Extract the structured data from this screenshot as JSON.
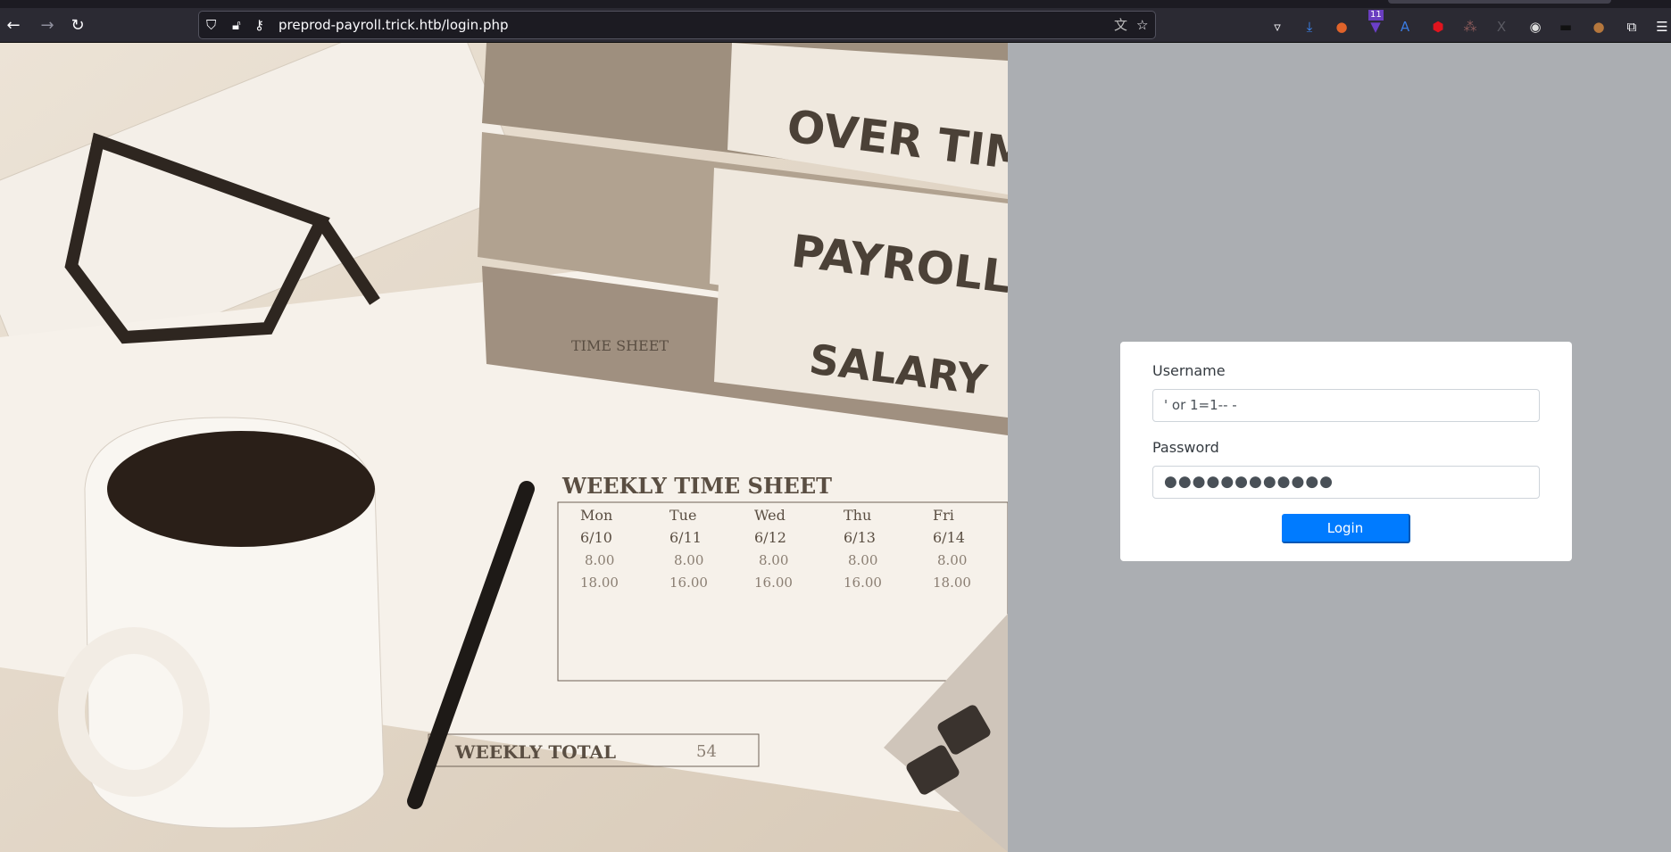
{
  "browser": {
    "url": "preprod-payroll.trick.htb/login.php",
    "extension_badge": "11",
    "extension_x_label": "X"
  },
  "photo": {
    "binder_labels": [
      "OVER TIME",
      "PAYROLL",
      "SALARY"
    ],
    "sheet_title": "WEEKLY TIME SHEET",
    "time_sheet_title": "TIME SHEET",
    "days": [
      "Mon",
      "Tue",
      "Wed",
      "Thu",
      "Fri"
    ],
    "dates": [
      "6/10",
      "6/11",
      "6/12",
      "6/13",
      "6/14"
    ],
    "time_in": [
      "8.00",
      "8.00",
      "8.00",
      "8.00",
      "8.00"
    ],
    "time_out": [
      "18.00",
      "16.00",
      "16.00",
      "16.00",
      "18.00"
    ],
    "weekly_total_label": "WEEKLY TOTAL",
    "weekly_total": "54"
  },
  "login": {
    "username_label": "Username",
    "username_value": "' or 1=1-- -",
    "password_label": "Password",
    "password_value": "●●●●●●●●●●●●",
    "button_label": "Login"
  }
}
